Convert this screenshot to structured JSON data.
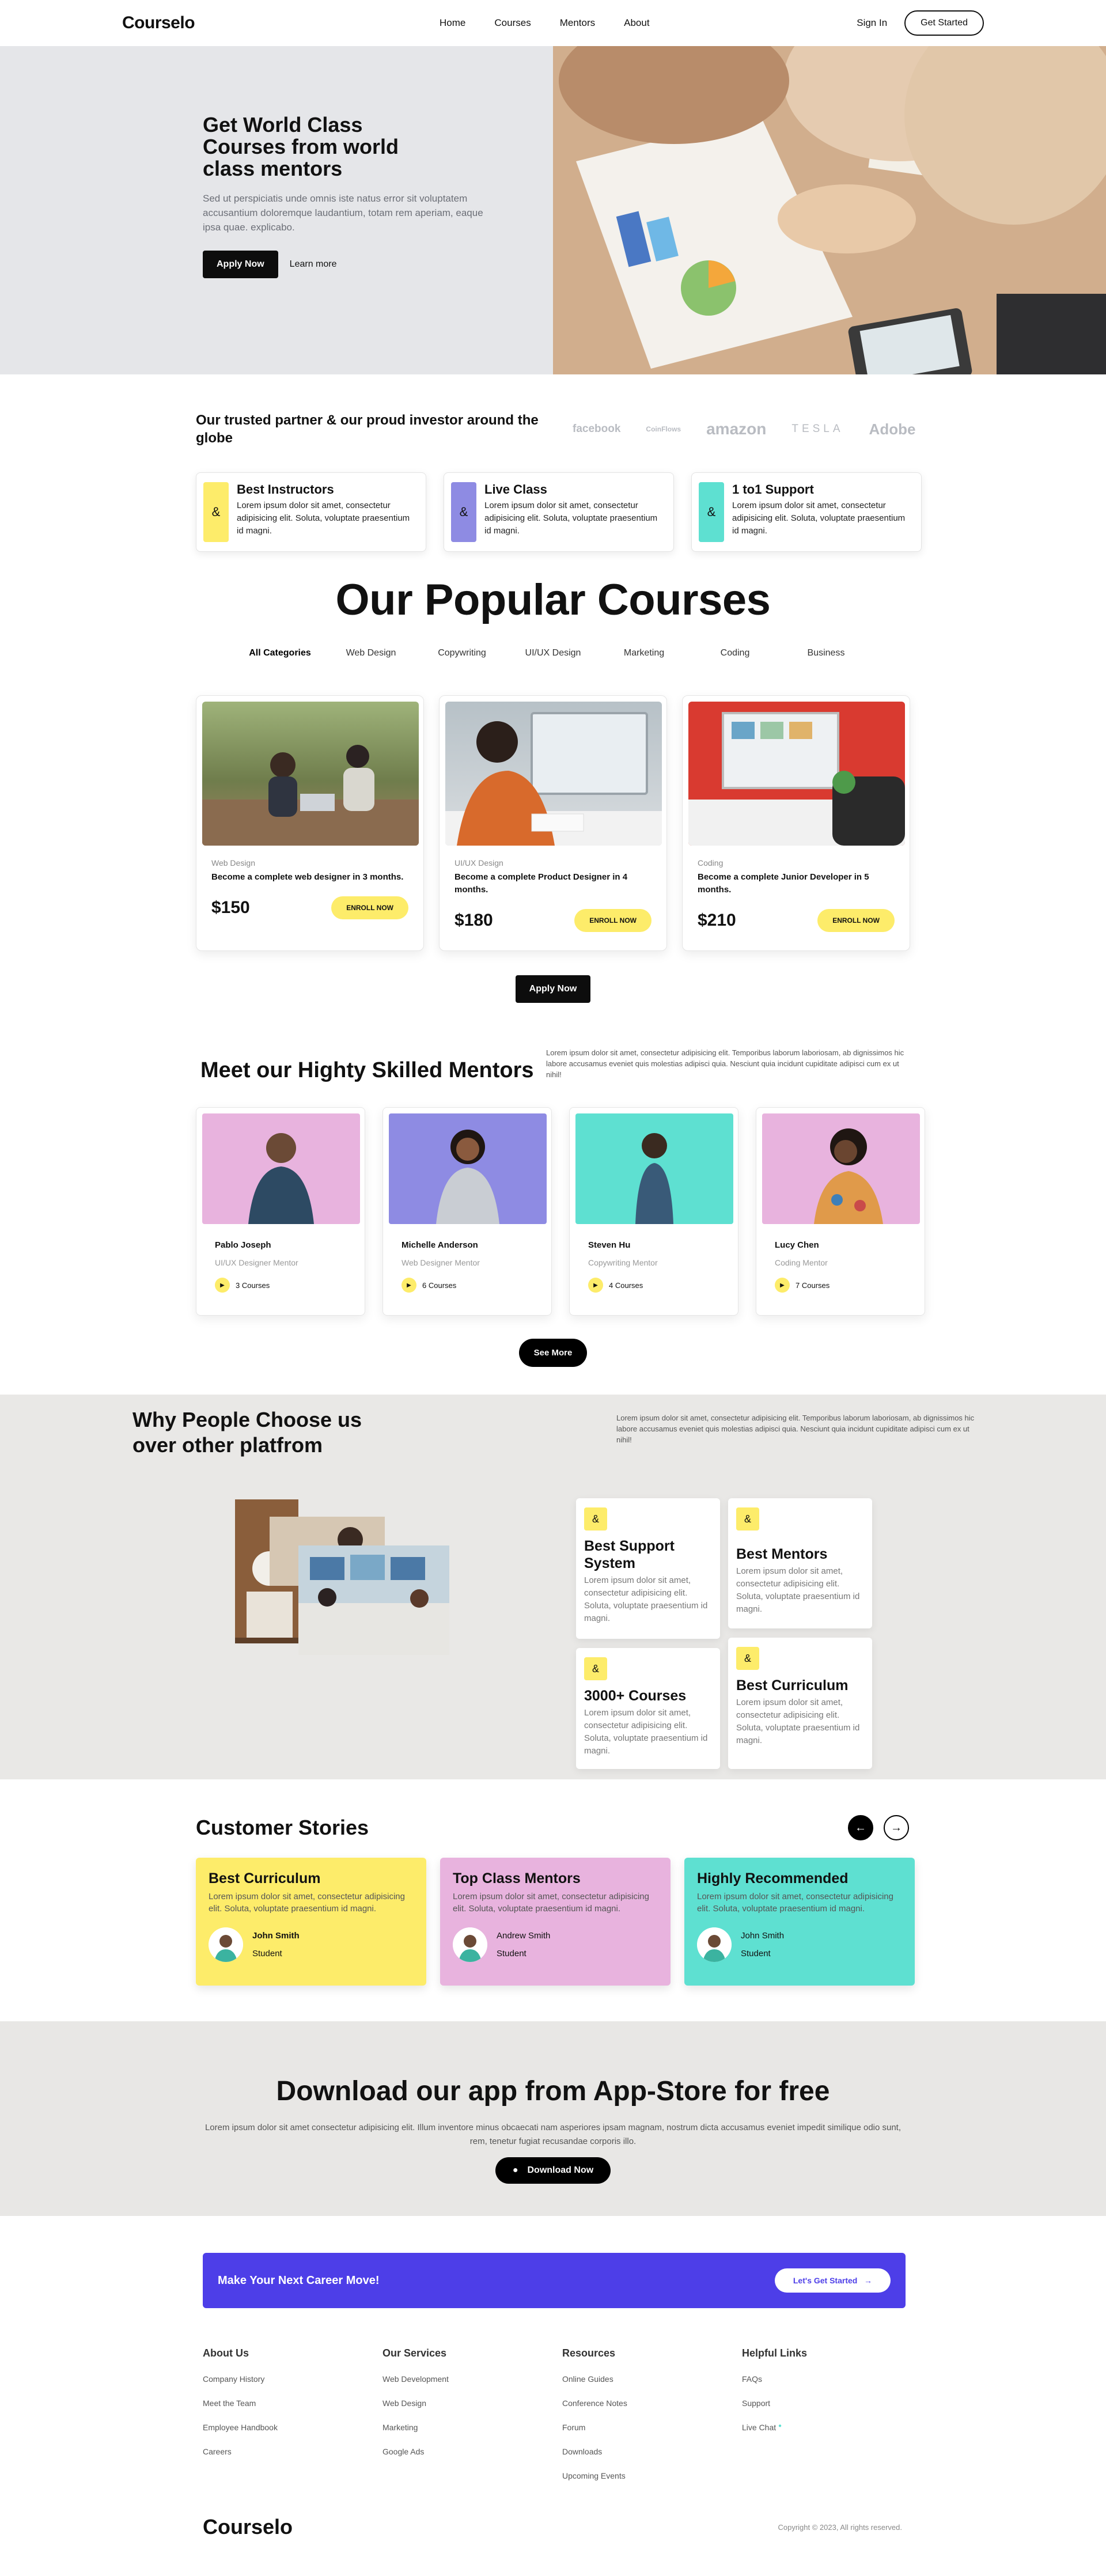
{
  "nav": {
    "logo": "Courselo",
    "links": [
      "Home",
      "Courses",
      "Mentors",
      "About"
    ],
    "signin": "Sign In",
    "get_started": "Get Started"
  },
  "hero": {
    "title": "Get World Class Courses from world class mentors",
    "text": "Sed ut perspiciatis unde omnis iste natus error sit voluptatem accusantium doloremque laudantium, totam rem aperiam, eaque ipsa quae. explicabo.",
    "apply": "Apply Now",
    "learn": "Learn more"
  },
  "partners": {
    "title": "Our trusted partner & our proud investor around the globe",
    "logos": [
      "facebook",
      "CoinFlows",
      "amazon",
      "TESLA",
      "Adobe"
    ]
  },
  "features": [
    {
      "title": "Best Instructors",
      "text": "Lorem ipsum dolor sit amet, consectetur adipisicing elit. Soluta, voluptate praesentium id magni.",
      "color": "#fdec6a"
    },
    {
      "title": "Live Class",
      "text": "Lorem ipsum dolor sit amet, consectetur adipisicing elit. Soluta, voluptate praesentium id magni.",
      "color": "#8e8be3"
    },
    {
      "title": "1 to1 Support",
      "text": "Lorem ipsum dolor sit amet, consectetur adipisicing elit. Soluta, voluptate praesentium id magni.",
      "color": "#5ee0d1"
    }
  ],
  "popular": {
    "title": "Our Popular Courses",
    "tabs": [
      "All Categories",
      "Web Design",
      "Copywriting",
      "UI/UX Design",
      "Marketing",
      "Coding",
      "Business"
    ],
    "courses": [
      {
        "category": "Web Design",
        "title": "Become a complete web designer in 3 months.",
        "price": "$150",
        "button": "ENROLL NOW"
      },
      {
        "category": "UI/UX Design",
        "title": "Become a complete Product Designer in 4 months.",
        "price": "$180",
        "button": "ENROLL NOW"
      },
      {
        "category": "Coding",
        "title": "Become a complete Junior Developer in 5 months.",
        "price": "$210",
        "button": "ENROLL NOW"
      }
    ],
    "apply": "Apply Now"
  },
  "mentors": {
    "title": "Meet our Highty Skilled Mentors",
    "text": "Lorem ipsum dolor sit amet, consectetur adipisicing elit. Temporibus laborum laboriosam, ab dignissimos hic labore accusamus eveniet quis molestias adipisci quia. Nesciunt quia incidunt cupiditate adipisci cum ex ut nihil!",
    "list": [
      {
        "name": "Pablo Joseph",
        "role": "UI/UX Designer Mentor",
        "courses": "3 Courses",
        "bg": "#e8b3de"
      },
      {
        "name": "Michelle Anderson",
        "role": "Web Designer Mentor",
        "courses": "6 Courses",
        "bg": "#8e8be3"
      },
      {
        "name": "Steven Hu",
        "role": "Copywriting Mentor",
        "courses": "4 Courses",
        "bg": "#5ee0d1"
      },
      {
        "name": "Lucy Chen",
        "role": "Coding Mentor",
        "courses": "7 Courses",
        "bg": "#e8b3de"
      }
    ],
    "see_more": "See More"
  },
  "why": {
    "title": "Why People Choose us over other platfrom",
    "text": "Lorem ipsum dolor sit amet, consectetur adipisicing elit. Temporibus laborum laboriosam, ab dignissimos hic labore accusamus eveniet quis molestias adipisci quia. Nesciunt quia incidunt cupiditate adipisci cum ex ut nihil!",
    "cards": [
      {
        "title": "Best Support System",
        "text": "Lorem ipsum dolor sit amet, consectetur adipisicing elit. Soluta, voluptate praesentium id magni."
      },
      {
        "title": "Best Mentors",
        "text": "Lorem ipsum dolor sit amet, consectetur adipisicing elit. Soluta, voluptate praesentium id magni."
      },
      {
        "title": "3000+ Courses",
        "text": "Lorem ipsum dolor sit amet, consectetur adipisicing elit. Soluta, voluptate praesentium id magni."
      },
      {
        "title": "Best Curriculum",
        "text": "Lorem ipsum dolor sit amet, consectetur adipisicing elit. Soluta, voluptate praesentium id magni."
      }
    ]
  },
  "stories": {
    "title": "Customer Stories",
    "list": [
      {
        "title": "Best Curriculum",
        "text": "Lorem ipsum dolor sit amet, consectetur adipisicing elit. Soluta, voluptate praesentium id magni.",
        "name": "John Smith",
        "role": "Student",
        "bg": "#fdec6a"
      },
      {
        "title": "Top Class Mentors",
        "text": "Lorem ipsum dolor sit amet, consectetur adipisicing elit. Soluta, voluptate praesentium id magni.",
        "name": "Andrew Smith",
        "role": "Student",
        "bg": "#e8b3de"
      },
      {
        "title": "Highly Recommended",
        "text": "Lorem ipsum dolor sit amet, consectetur adipisicing elit. Soluta, voluptate praesentium id magni.",
        "name": "John Smith",
        "role": "Student",
        "bg": "#5ee0d1"
      }
    ]
  },
  "download": {
    "title": "Download our app from App-Store for free",
    "text": "Lorem ipsum dolor sit amet consectetur adipisicing elit. Illum inventore minus obcaecati nam asperiores ipsam magnam, nostrum dicta accusamus eveniet impedit similique odio sunt, rem, tenetur fugiat recusandae corporis illo.",
    "button": "Download Now"
  },
  "cta": {
    "title": "Make Your Next Career Move!",
    "button": "Let's Get Started"
  },
  "footer": {
    "columns": [
      {
        "head": "About Us",
        "items": [
          "Company History",
          "Meet the Team",
          "Employee Handbook",
          "Careers"
        ]
      },
      {
        "head": "Our Services",
        "items": [
          "Web Development",
          "Web Design",
          "Marketing",
          "Google Ads"
        ]
      },
      {
        "head": "Resources",
        "items": [
          "Online Guides",
          "Conference Notes",
          "Forum",
          "Downloads",
          "Upcoming Events"
        ]
      },
      {
        "head": "Helpful Links",
        "items": [
          "FAQs",
          "Support",
          "Live Chat"
        ]
      }
    ],
    "logo": "Courselo",
    "copyright": "Copyright © 2023, All rights reserved."
  }
}
